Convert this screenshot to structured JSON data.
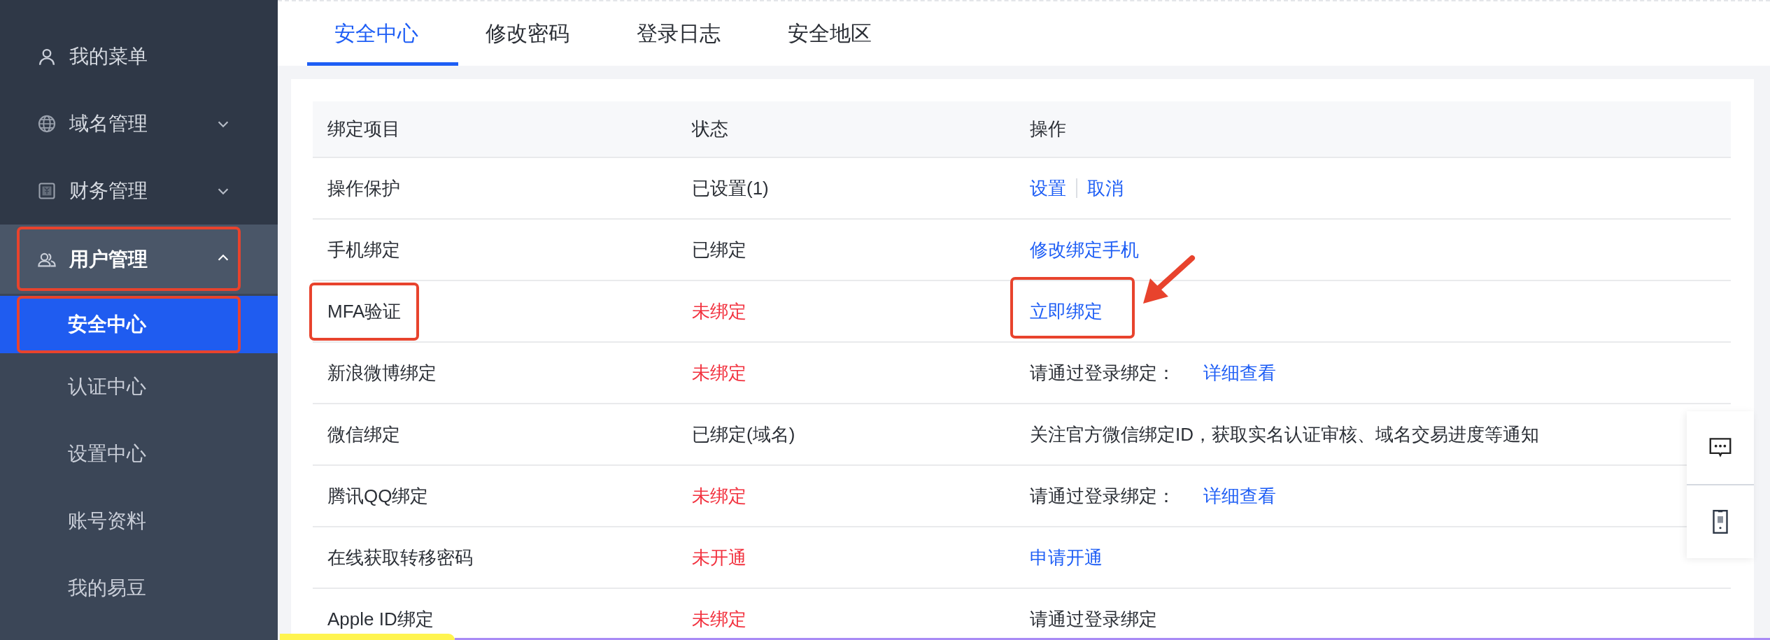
{
  "sidebar": {
    "items": [
      {
        "label": "我的菜单",
        "marked": false
      },
      {
        "label": "域名管理",
        "expanded": false,
        "marked": false
      },
      {
        "label": "财务管理",
        "expanded": false,
        "marked": false
      },
      {
        "label": "用户管理",
        "expanded": true,
        "marked": true,
        "children": [
          {
            "label": "安全中心",
            "selected": true,
            "marked": true
          },
          {
            "label": "认证中心",
            "selected": false,
            "marked": false
          },
          {
            "label": "设置中心",
            "selected": false,
            "marked": false
          },
          {
            "label": "账号资料",
            "selected": false,
            "marked": false
          },
          {
            "label": "我的易豆",
            "selected": false,
            "marked": false
          }
        ]
      }
    ]
  },
  "tabs": [
    {
      "label": "安全中心",
      "selected": true
    },
    {
      "label": "修改密码",
      "selected": false
    },
    {
      "label": "登录日志",
      "selected": false
    },
    {
      "label": "安全地区",
      "selected": false
    }
  ],
  "table": {
    "columns": [
      "绑定项目",
      "状态",
      "操作"
    ],
    "rows": [
      {
        "item": "操作保护",
        "status": "已设置(1)",
        "bound": true,
        "marked": false,
        "actions": [
          {
            "kind": "link",
            "label": "设置",
            "marked": false
          },
          {
            "kind": "link",
            "label": "取消",
            "marked": false
          }
        ]
      },
      {
        "item": "手机绑定",
        "status": "已绑定",
        "bound": true,
        "marked": false,
        "actions": [
          {
            "kind": "link",
            "label": "修改绑定手机",
            "marked": false
          }
        ]
      },
      {
        "item": "MFA验证",
        "status": "未绑定",
        "bound": false,
        "marked": true,
        "actions": [
          {
            "kind": "link",
            "label": "立即绑定",
            "marked": true
          }
        ]
      },
      {
        "item": "新浪微博绑定",
        "status": "未绑定",
        "bound": false,
        "marked": false,
        "actions": [
          {
            "kind": "text",
            "label": "请通过登录绑定：",
            "marked": false
          },
          {
            "kind": "link",
            "label": "详细查看",
            "marked": false
          }
        ]
      },
      {
        "item": "微信绑定",
        "status": "已绑定(域名)",
        "bound": true,
        "marked": false,
        "actions": [
          {
            "kind": "text",
            "label": "关注官方微信绑定ID，获取实名认证审核、域名交易进度等通知",
            "marked": false
          }
        ]
      },
      {
        "item": "腾讯QQ绑定",
        "status": "未绑定",
        "bound": false,
        "marked": false,
        "actions": [
          {
            "kind": "text",
            "label": "请通过登录绑定：",
            "marked": false
          },
          {
            "kind": "link",
            "label": "详细查看",
            "marked": false
          }
        ]
      },
      {
        "item": "在线获取转移密码",
        "status": "未开通",
        "bound": false,
        "marked": false,
        "actions": [
          {
            "kind": "link",
            "label": "申请开通",
            "marked": false
          }
        ]
      },
      {
        "item": "Apple ID绑定",
        "status": "未绑定",
        "bound": false,
        "marked": false,
        "actions": [
          {
            "kind": "text",
            "label": "请通过登录绑定",
            "marked": false
          }
        ]
      }
    ]
  }
}
